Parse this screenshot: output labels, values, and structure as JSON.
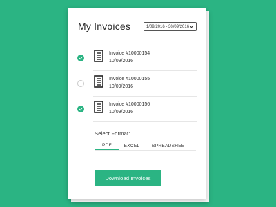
{
  "header": {
    "title": "My Invoices",
    "date_range": "1/09/2016 - 30/09/2016"
  },
  "invoices": [
    {
      "name": "Invoice #10000154",
      "date": "10/09/2016",
      "selected": true
    },
    {
      "name": "Invoice #10000155",
      "date": "10/09/2016",
      "selected": false
    },
    {
      "name": "Invoice #10000156",
      "date": "10/09/2016",
      "selected": true
    }
  ],
  "format": {
    "label": "Select Format:",
    "options": [
      "PDF",
      "EXCEL",
      "SPREADSHEET"
    ],
    "selected": "PDF"
  },
  "actions": {
    "download_label": "Download Invoices"
  },
  "colors": {
    "accent": "#2bb483",
    "background": "#2bb483",
    "card": "#ffffff"
  },
  "icons": {
    "date_select": "chevron-down-icon",
    "invoice": "document-icon",
    "selected": "check-icon"
  }
}
